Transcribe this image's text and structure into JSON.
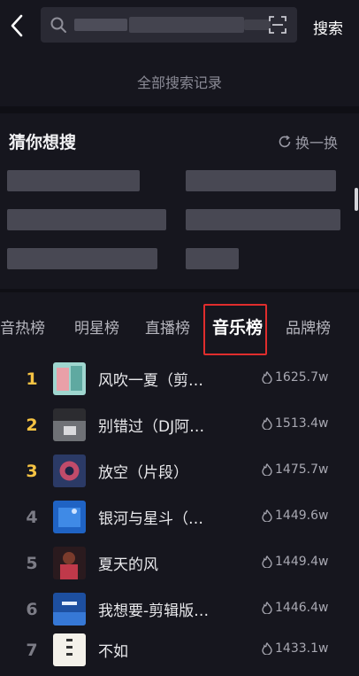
{
  "header": {
    "search_button": "搜索"
  },
  "history": {
    "all_label": "全部搜索记录"
  },
  "guess": {
    "title": "猜你想搜",
    "refresh_label": "换一换"
  },
  "tabs": [
    {
      "label": "音热榜"
    },
    {
      "label": "明星榜"
    },
    {
      "label": "直播榜"
    },
    {
      "label": "音乐榜",
      "active": true
    },
    {
      "label": "品牌榜"
    }
  ],
  "ranking": [
    {
      "rank": "1",
      "title": "风吹一夏（剪…",
      "heat": "1625.7w",
      "top": true
    },
    {
      "rank": "2",
      "title": "别错过（DJ阿…",
      "heat": "1513.4w",
      "top": true
    },
    {
      "rank": "3",
      "title": "放空（片段）",
      "heat": "1475.7w",
      "top": true
    },
    {
      "rank": "4",
      "title": "银河与星斗（…",
      "heat": "1449.6w",
      "top": false
    },
    {
      "rank": "5",
      "title": "夏天的风",
      "heat": "1449.4w",
      "top": false
    },
    {
      "rank": "6",
      "title": "我想要-剪辑版…",
      "heat": "1446.4w",
      "top": false
    },
    {
      "rank": "7",
      "title": "不如",
      "heat": "1433.1w",
      "top": false
    }
  ],
  "colors": {
    "accent_top_rank": "#f6c343",
    "tab_highlight": "#e02d2d",
    "background": "#16161e"
  }
}
